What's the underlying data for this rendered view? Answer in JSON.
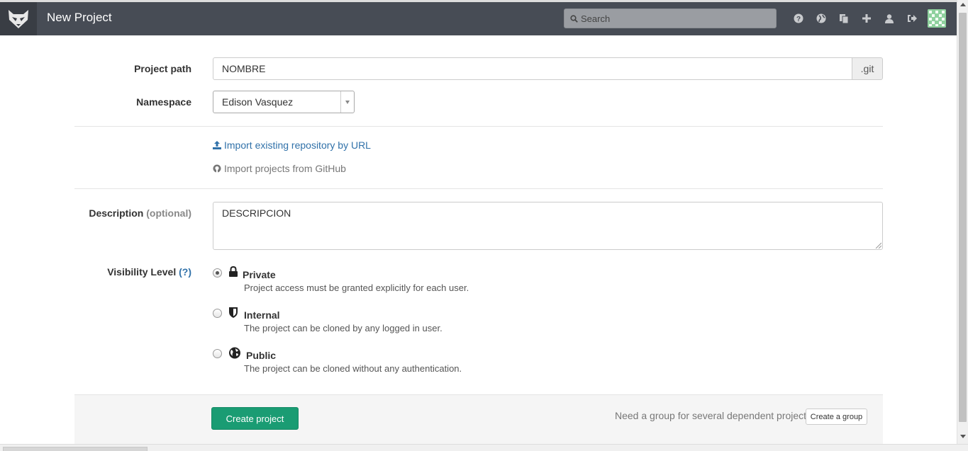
{
  "header": {
    "title": "New Project",
    "search_placeholder": "Search",
    "icons": [
      "help-icon",
      "globe-icon",
      "copy-icon",
      "plus-icon",
      "user-icon",
      "sign-out-icon"
    ],
    "accent": "#474c55"
  },
  "form": {
    "project_path": {
      "label": "Project path",
      "value": "NOMBRE",
      "suffix": ".git"
    },
    "namespace": {
      "label": "Namespace",
      "selected": "Edison Vasquez"
    },
    "imports": {
      "url_label": "Import existing repository by URL",
      "github_label": "Import projects from GitHub"
    },
    "description": {
      "label": "Description",
      "optional": "(optional)",
      "value": "DESCRIPCION"
    },
    "visibility": {
      "label": "Visibility Level",
      "help": "(?)",
      "options": [
        {
          "title": "Private",
          "desc": "Project access must be granted explicitly for each user.",
          "checked": true,
          "icon": "lock-icon"
        },
        {
          "title": "Internal",
          "desc": "The project can be cloned by any logged in user.",
          "checked": false,
          "icon": "shield-icon"
        },
        {
          "title": "Public",
          "desc": "The project can be cloned without any authentication.",
          "checked": false,
          "icon": "globe-icon"
        }
      ]
    }
  },
  "footer": {
    "create_label": "Create project",
    "group_hint": "Need a group for several dependent projects?",
    "group_button": "Create a group",
    "create_color": "#1a9c73"
  }
}
